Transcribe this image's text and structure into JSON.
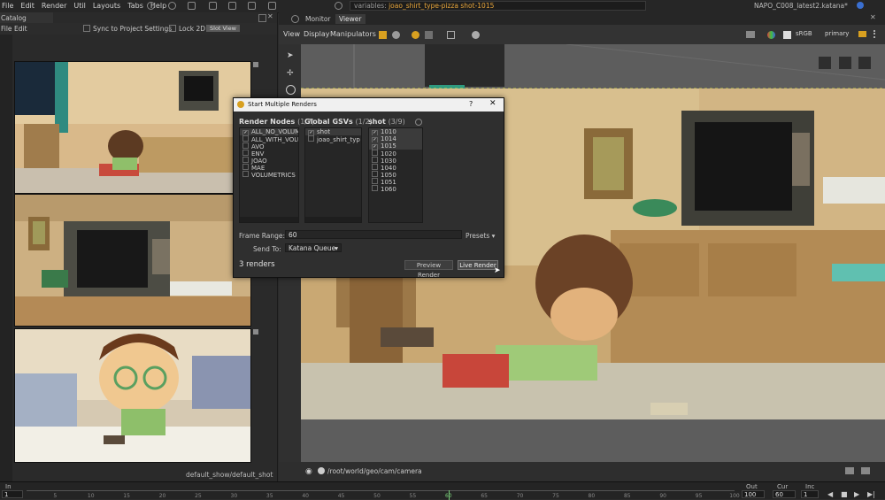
{
  "menubar": {
    "items": [
      "File",
      "Edit",
      "Render",
      "Util",
      "Layouts",
      "Tabs",
      "Help"
    ],
    "variables_label": "variables:",
    "variables_value": "joao_shirt_type-pizza shot-1015",
    "project_file": "NAPO_C008_latest2.katana*"
  },
  "catalog": {
    "tab_label": "Catalog",
    "menu_file": "File",
    "menu_edit": "Edit",
    "sync_label": "Sync to Project Settings",
    "lock2d_label": "Lock 2D",
    "slot_view_label": "Slot View",
    "footer": "default_show/default_shot"
  },
  "viewer": {
    "tabs": [
      "Monitor",
      "Viewer"
    ],
    "active_tab": "Viewer",
    "menu": [
      "View",
      "Display",
      "Manipulators"
    ],
    "colorspace": "sRGB",
    "view_mode": "primary",
    "camera_path": "/root/world/geo/cam/camera"
  },
  "dialog": {
    "title": "Start Multiple Renders",
    "help": "?",
    "close": "✕",
    "render_nodes": {
      "header": "Render Nodes",
      "count": "(1/7)",
      "items": [
        {
          "label": "ALL_NO_VOLUM",
          "checked": true
        },
        {
          "label": "ALL_WITH_VOLU",
          "checked": false
        },
        {
          "label": "AVO",
          "checked": false
        },
        {
          "label": "ENV",
          "checked": false
        },
        {
          "label": "JOAO",
          "checked": false
        },
        {
          "label": "MAE",
          "checked": false
        },
        {
          "label": "VOLUMETRICS",
          "checked": false
        }
      ]
    },
    "gsvs": {
      "header": "Global GSVs",
      "count": "(1/2)",
      "items": [
        {
          "label": "shot",
          "checked": true
        },
        {
          "label": "joao_shirt_typ",
          "checked": false
        }
      ]
    },
    "shots": {
      "header": "shot",
      "count": "(3/9)",
      "items": [
        {
          "label": "1010",
          "checked": true
        },
        {
          "label": "1014",
          "checked": true
        },
        {
          "label": "1015",
          "checked": true
        },
        {
          "label": "1020",
          "checked": false
        },
        {
          "label": "1030",
          "checked": false
        },
        {
          "label": "1040",
          "checked": false
        },
        {
          "label": "1050",
          "checked": false
        },
        {
          "label": "1051",
          "checked": false
        },
        {
          "label": "1060",
          "checked": false
        }
      ]
    },
    "frame_range_label": "Frame Range:",
    "frame_range_value": "60",
    "presets_label": "Presets ▾",
    "send_to_label": "Send To:",
    "send_to_value": "Katana Queue",
    "renders_count": "3 renders",
    "preview_button": "Preview Render",
    "live_button": "Live Render"
  },
  "timeline": {
    "in_label": "In",
    "in_value": "1",
    "out_label": "Out",
    "out_value": "100",
    "cur_label": "Cur",
    "cur_value": "60",
    "inc_label": "Inc",
    "inc_value": "1",
    "ticks": [
      "5",
      "10",
      "15",
      "20",
      "25",
      "30",
      "35",
      "40",
      "45",
      "50",
      "55",
      "60",
      "65",
      "70",
      "75",
      "80",
      "85",
      "90",
      "95",
      "100"
    ],
    "current_frame": 60
  }
}
